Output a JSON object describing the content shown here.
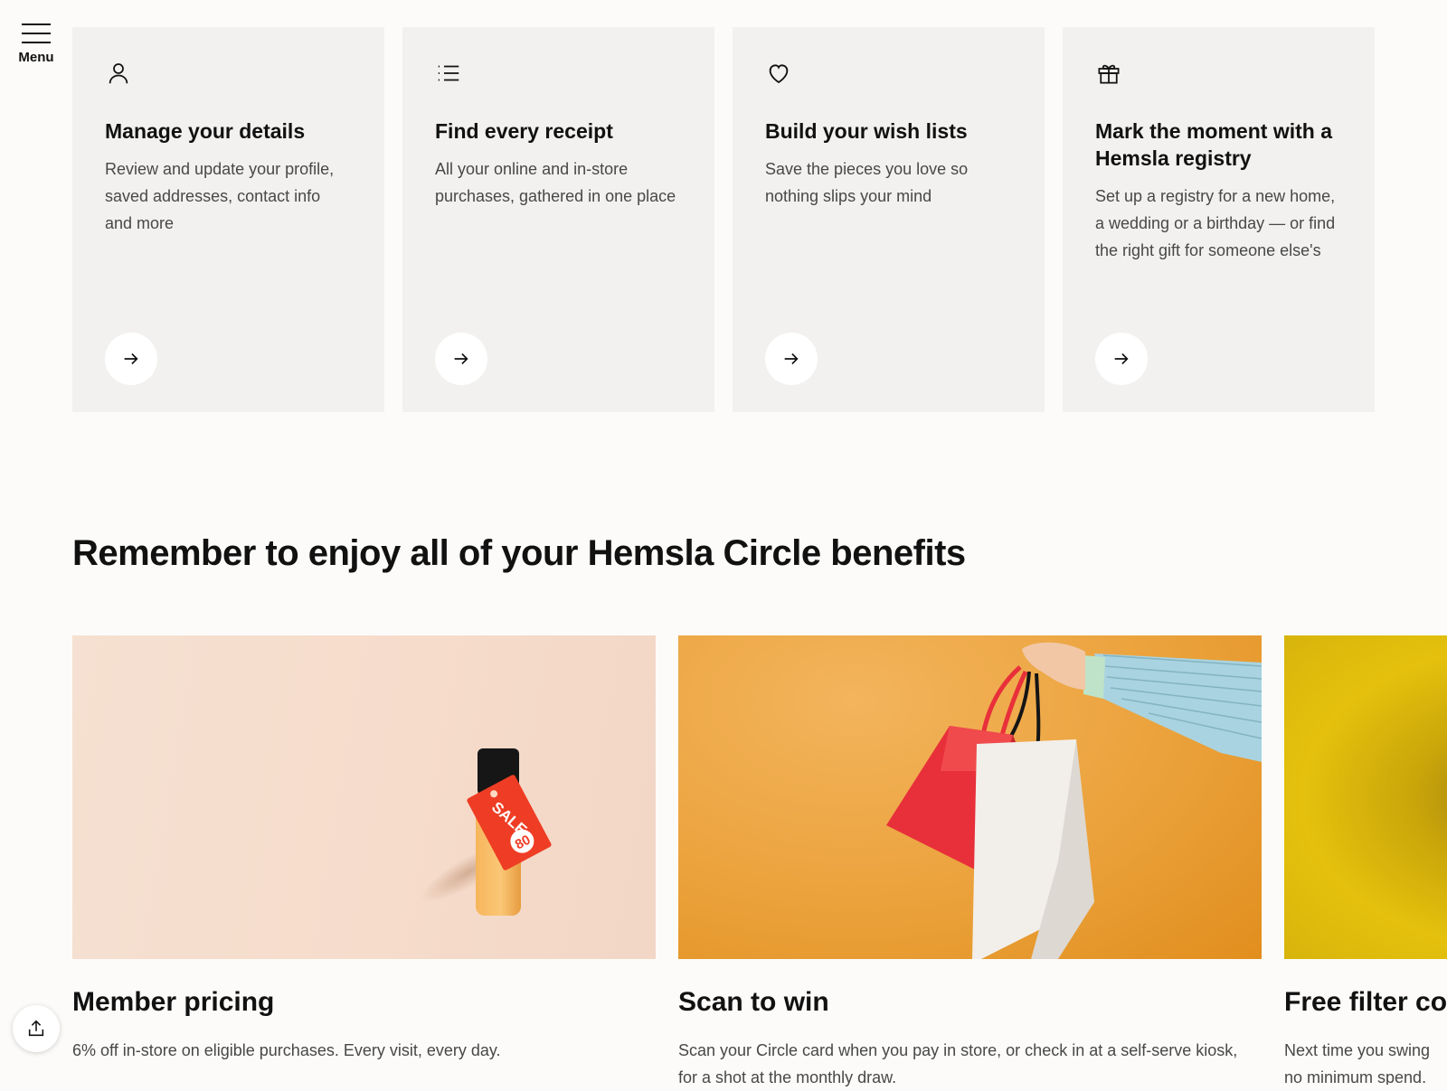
{
  "nav": {
    "menu_label": "Menu",
    "menu_icon": "hamburger-icon"
  },
  "account_cards": [
    {
      "icon": "user-icon",
      "title": "Manage your details",
      "description": "Review and update your profile, saved addresses, contact info and more"
    },
    {
      "icon": "list-icon",
      "title": "Find every receipt",
      "description": "All your online and in-store purchases, gathered in one place"
    },
    {
      "icon": "heart-icon",
      "title": "Build your wish lists",
      "description": "Save the pieces you love so nothing slips your mind"
    },
    {
      "icon": "gift-icon",
      "title": "Mark the moment with a Hemsla registry",
      "description": "Set up a registry for a new home, a wedding or a birthday — or find the right gift for someone else's"
    }
  ],
  "benefits_section": {
    "title": "Remember to enjoy all of your Hemsla Circle benefits",
    "items": [
      {
        "title": "Member pricing",
        "description": "6% off in-store on eligible purchases. Every visit, every day.",
        "image_tag_text": "SALE",
        "image_tag_badge": "80"
      },
      {
        "title": "Scan to win",
        "description": "Scan your Circle card when you pay in store, or check in at a self-serve kiosk, for a shot at the monthly draw."
      },
      {
        "title": "Free filter cof",
        "description": "Next time you swing no minimum spend."
      }
    ]
  },
  "share_button": {
    "icon": "share-icon"
  },
  "colors": {
    "card_bg": "#f2f1ef",
    "page_bg": "#fcfbf9",
    "text": "#111111",
    "muted_text": "#484848",
    "accent_red": "#ee3d24",
    "accent_orange": "#eaa33c"
  }
}
